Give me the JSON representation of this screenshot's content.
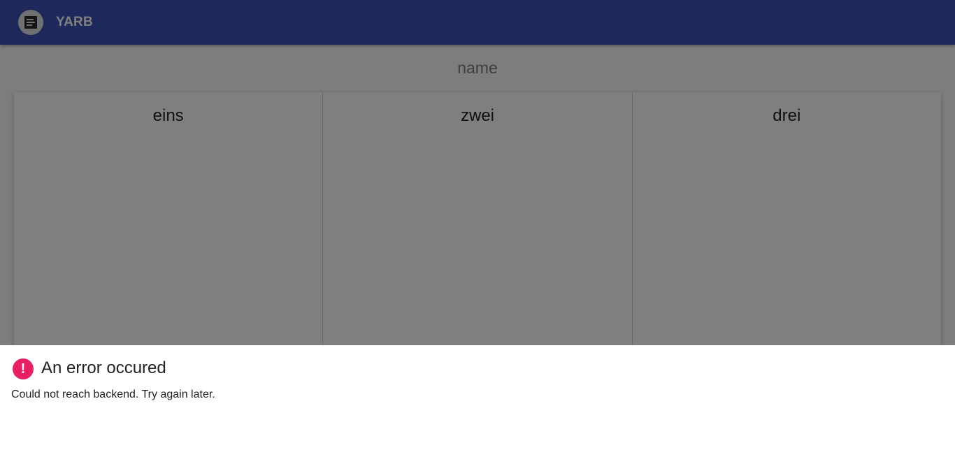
{
  "header": {
    "app_title": "YARB",
    "logo_icon": "document-icon",
    "bar_color": "#3f51b5"
  },
  "board": {
    "name": "name",
    "columns": [
      {
        "title": "eins"
      },
      {
        "title": "zwei"
      },
      {
        "title": "drei"
      }
    ]
  },
  "error_sheet": {
    "icon": "error-icon",
    "title": "An error occured",
    "message": "Could not reach backend. Try again later.",
    "accent_color": "#e91e63"
  }
}
